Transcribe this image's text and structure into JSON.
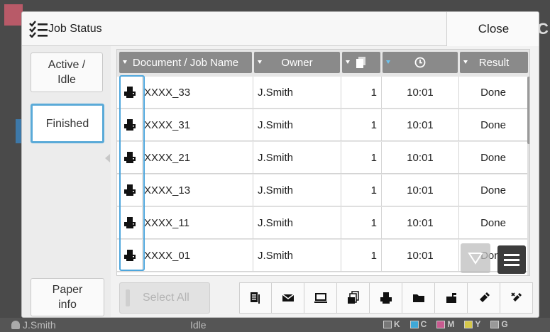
{
  "background": {
    "user_name": "J.Smith",
    "machine_status": "Idle",
    "ink_labels": [
      "K",
      "C",
      "M",
      "Y",
      "G"
    ]
  },
  "dialog": {
    "title": "Job Status",
    "close_label": "Close"
  },
  "tabs": {
    "active_idle": "Active / Idle",
    "finished": "Finished",
    "paper_info": "Paper info"
  },
  "table": {
    "headers": {
      "name": "Document / Job Name",
      "owner": "Owner",
      "copies_icon": "document-stack-icon",
      "time_icon": "clock-icon",
      "result": "Result"
    },
    "rows": [
      {
        "name": "XXXX_33",
        "owner": "J.Smith",
        "copies": "1",
        "time": "10:01",
        "result": "Done"
      },
      {
        "name": "XXXX_31",
        "owner": "J.Smith",
        "copies": "1",
        "time": "10:01",
        "result": "Done"
      },
      {
        "name": "XXXX_21",
        "owner": "J.Smith",
        "copies": "1",
        "time": "10:01",
        "result": "Done"
      },
      {
        "name": "XXXX_13",
        "owner": "J.Smith",
        "copies": "1",
        "time": "10:01",
        "result": "Done"
      },
      {
        "name": "XXXX_11",
        "owner": "J.Smith",
        "copies": "1",
        "time": "10:01",
        "result": "Done"
      },
      {
        "name": "XXXX_01",
        "owner": "J.Smith",
        "copies": "1",
        "time": "10:01",
        "result": "Done"
      }
    ]
  },
  "bottom": {
    "select_all": "Select All",
    "actions": [
      "copy-icon",
      "mail-icon",
      "pc-icon",
      "print-copies-icon",
      "printer-icon",
      "folder-icon",
      "mailbox-icon",
      "usb-icon",
      "usb-remove-icon"
    ]
  },
  "colors": {
    "highlight": "#4ea6dc",
    "header_bg": "#8a8a8a"
  }
}
